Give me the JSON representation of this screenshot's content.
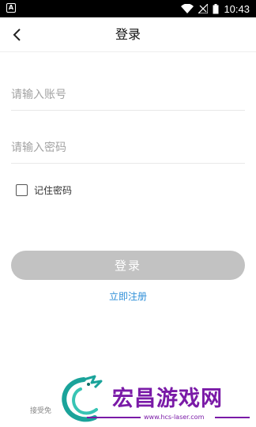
{
  "status_bar": {
    "time": "10:43",
    "app_icon": "A"
  },
  "nav": {
    "title": "登录"
  },
  "form": {
    "account_placeholder": "请输入账号",
    "password_placeholder": "请输入密码",
    "remember_label": "记住密码",
    "remember_checked": false
  },
  "login_button": "登录",
  "register_link": "立即注册",
  "terms_text": "接受免",
  "watermark": {
    "title": "宏昌游戏网",
    "url": "www.hcs-laser.com"
  },
  "colors": {
    "link": "#2f8fd8",
    "button_disabled": "#c2c2c2",
    "watermark": "#7a1aa7"
  }
}
